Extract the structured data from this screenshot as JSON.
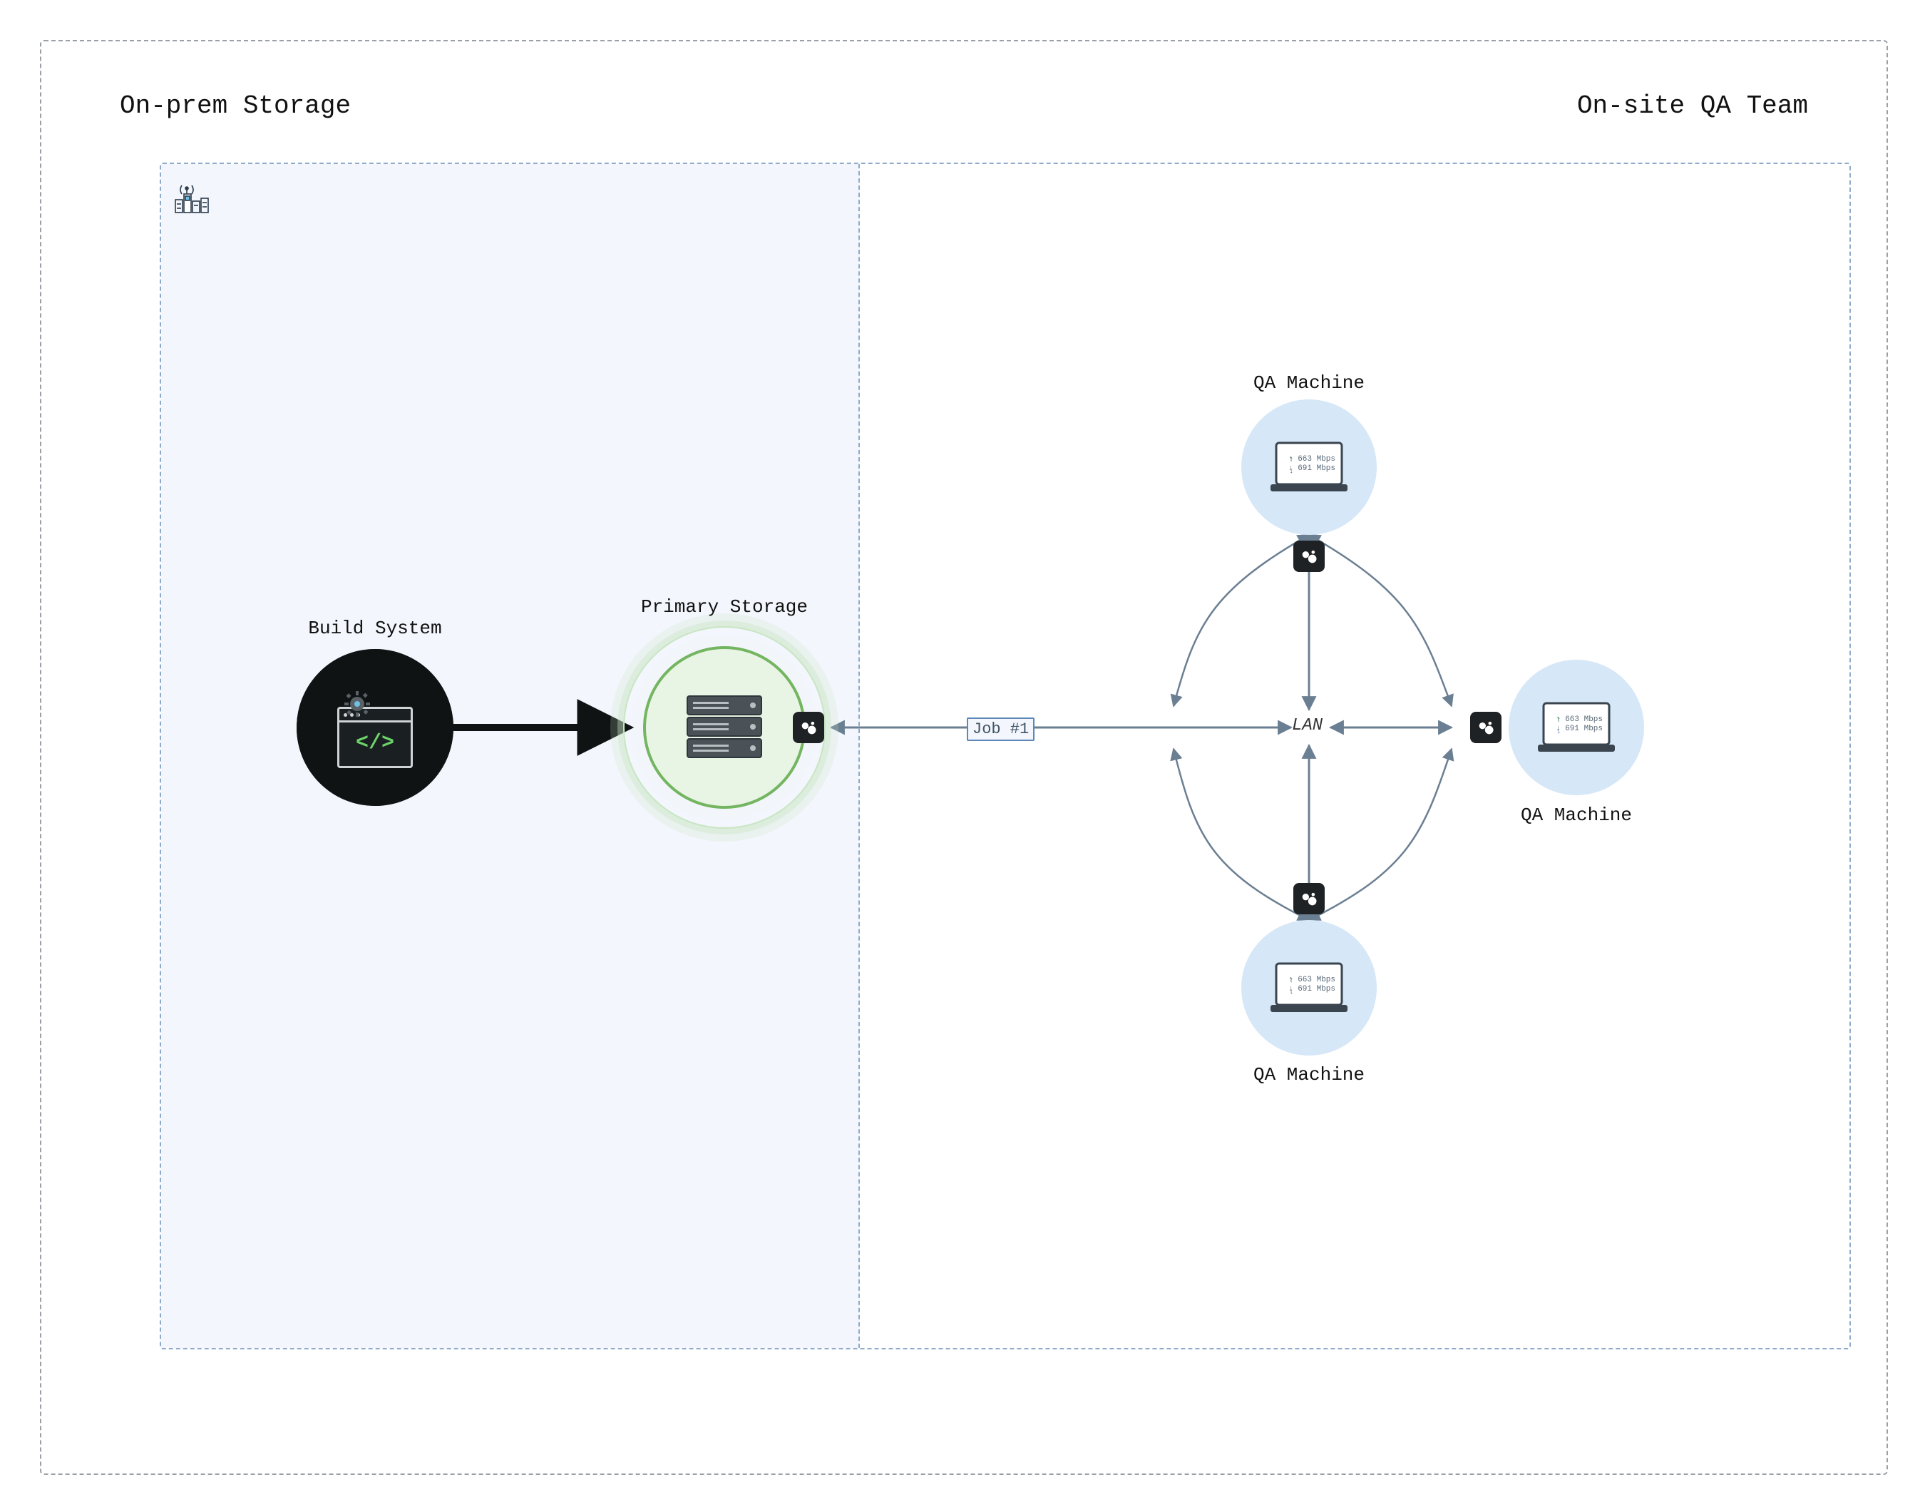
{
  "sections": {
    "left_title": "On-prem Storage",
    "right_title": "On-site QA Team"
  },
  "nodes": {
    "build_system": {
      "label": "Build System"
    },
    "primary_storage": {
      "label": "Primary Storage"
    },
    "qa_top": {
      "label": "QA Machine",
      "up": "↑ 663 Mbps",
      "down": "↓ 691 Mbps"
    },
    "qa_right": {
      "label": "QA Machine",
      "up": "↑ 663 Mbps",
      "down": "↓ 691 Mbps"
    },
    "qa_bottom": {
      "label": "QA Machine",
      "up": "↑ 663 Mbps",
      "down": "↓ 691 Mbps"
    }
  },
  "edges": {
    "job1": {
      "label": "Job #1"
    },
    "lan": {
      "label": "LAN"
    }
  },
  "icons": {
    "city": "city-antenna-icon",
    "gear": "gear-icon",
    "code": "code-window-icon",
    "server": "server-rack-icon",
    "laptop": "laptop-speed-icon",
    "app_badge": "resilio-agent-icon"
  },
  "colors": {
    "dashed_outer": "#9aa0a6",
    "dashed_inner": "#8faacc",
    "left_zone_bg": "#f3f6fc",
    "dark_node": "#0f1314",
    "green_stroke": "#74b561",
    "green_fill": "#e9f5e4",
    "blue_node": "#d6e7f7",
    "arrow_gray": "#6b7f92"
  }
}
